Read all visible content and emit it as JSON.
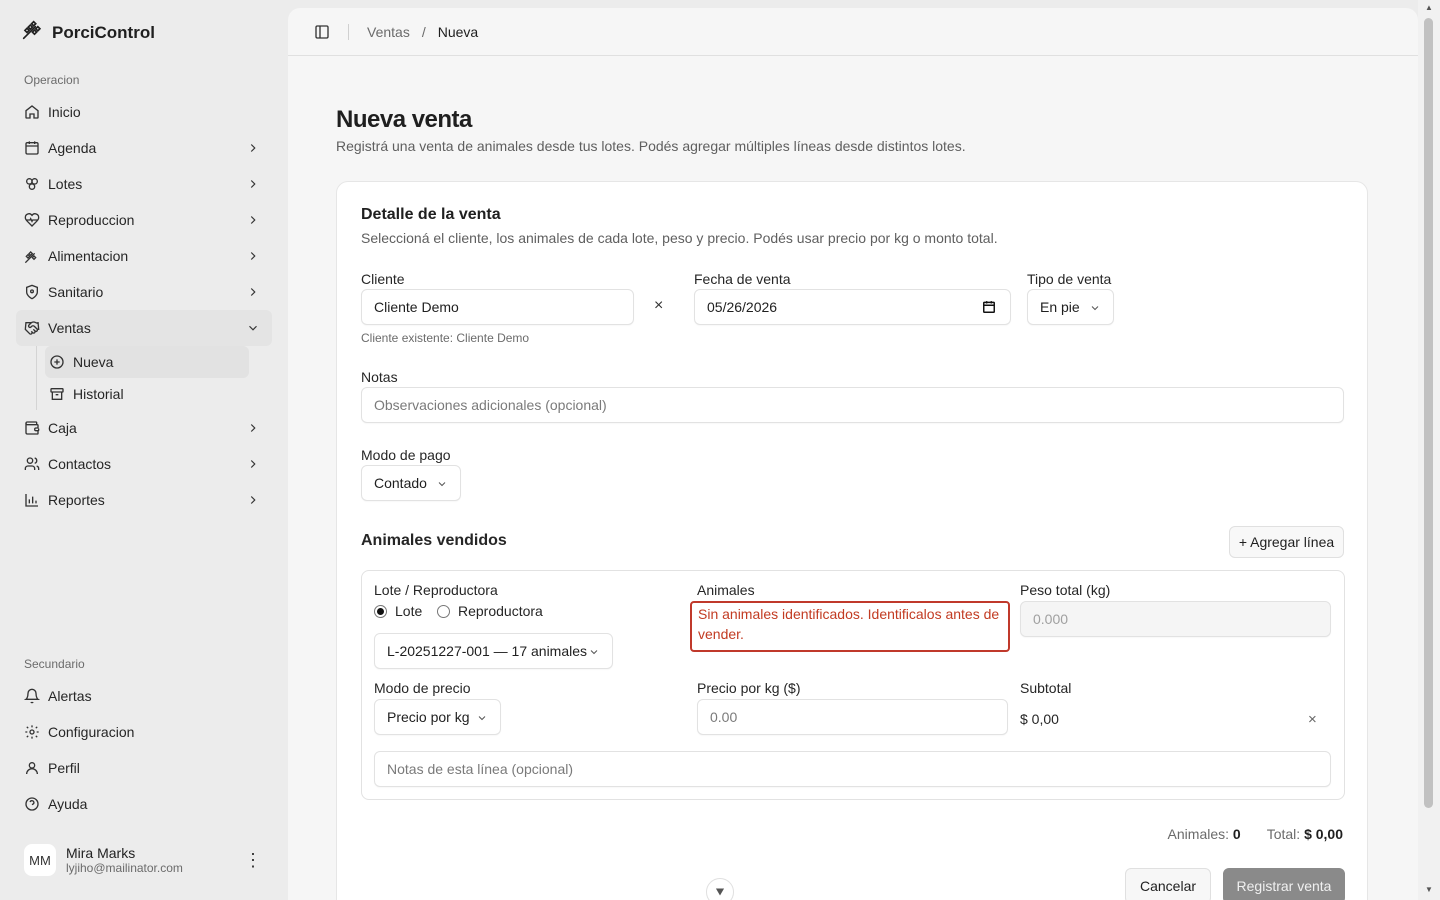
{
  "app": {
    "name": "PorciControl"
  },
  "sidebar": {
    "group_operacion": "Operacion",
    "items": [
      {
        "label": "Inicio",
        "icon": "home-icon"
      },
      {
        "label": "Agenda",
        "icon": "calendar-icon"
      },
      {
        "label": "Lotes",
        "icon": "lotes-icon"
      },
      {
        "label": "Reproduccion",
        "icon": "heart-pulse-icon"
      },
      {
        "label": "Alimentacion",
        "icon": "wheat-icon"
      },
      {
        "label": "Sanitario",
        "icon": "shield-icon"
      },
      {
        "label": "Ventas",
        "icon": "handshake-icon"
      },
      {
        "label": "Caja",
        "icon": "wallet-icon"
      },
      {
        "label": "Contactos",
        "icon": "users-icon"
      },
      {
        "label": "Reportes",
        "icon": "bar-chart-icon"
      }
    ],
    "ventas_sub": [
      {
        "label": "Nueva",
        "icon": "plus-circle-icon"
      },
      {
        "label": "Historial",
        "icon": "archive-icon"
      }
    ],
    "group_secundario": "Secundario",
    "secondary": [
      {
        "label": "Alertas",
        "icon": "bell-icon"
      },
      {
        "label": "Configuracion",
        "icon": "settings-icon"
      },
      {
        "label": "Perfil",
        "icon": "user-icon"
      },
      {
        "label": "Ayuda",
        "icon": "help-circle-icon"
      }
    ],
    "user": {
      "initials": "MM",
      "name": "Mira Marks",
      "email": "lyjiho@mailinator.com"
    }
  },
  "breadcrumb": {
    "parent": "Ventas",
    "separator": "/",
    "current": "Nueva"
  },
  "page": {
    "title": "Nueva venta",
    "subtitle": "Registrá una venta de animales desde tus lotes. Podés agregar múltiples líneas desde distintos lotes."
  },
  "form": {
    "title": "Detalle de la venta",
    "subtitle": "Seleccioná el cliente, los animales de cada lote, peso y precio. Podés usar precio por kg o monto total.",
    "cliente_label": "Cliente",
    "cliente_value": "Cliente Demo",
    "cliente_clear": "×",
    "cliente_hint": "Cliente existente: Cliente Demo",
    "fecha_label": "Fecha de venta",
    "fecha_value": "05/26/2026",
    "tipo_label": "Tipo de venta",
    "tipo_value": "En pie",
    "notas_label": "Notas",
    "notas_placeholder": "Observaciones adicionales (opcional)",
    "pago_label": "Modo de pago",
    "pago_value": "Contado",
    "animales_section": "Animales vendidos",
    "add_line": "+ Agregar línea",
    "line": {
      "lote_label": "Lote / Reproductora",
      "radio_lote": "Lote",
      "radio_repro": "Reproductora",
      "lote_value": "L-20251227-001 — 17 animales",
      "animales_label": "Animales",
      "animales_error": "Sin animales identificados. Identificalos antes de vender.",
      "peso_label": "Peso total (kg)",
      "peso_placeholder": "0.000",
      "modo_precio_label": "Modo de precio",
      "modo_precio_value": "Precio por kg",
      "precio_label": "Precio por kg ($)",
      "precio_placeholder": "0.00",
      "subtotal_label": "Subtotal",
      "subtotal_value": "$ 0,00",
      "remove": "×",
      "notas_placeholder": "Notas de esta línea (opcional)"
    },
    "totals": {
      "animales_label": "Animales:",
      "animales_value": "0",
      "total_label": "Total:",
      "total_value": "$ 0,00"
    },
    "cancel": "Cancelar",
    "submit": "Registrar venta"
  },
  "colors": {
    "error": "#c23b22",
    "submit_disabled": "#8a8a8a"
  }
}
